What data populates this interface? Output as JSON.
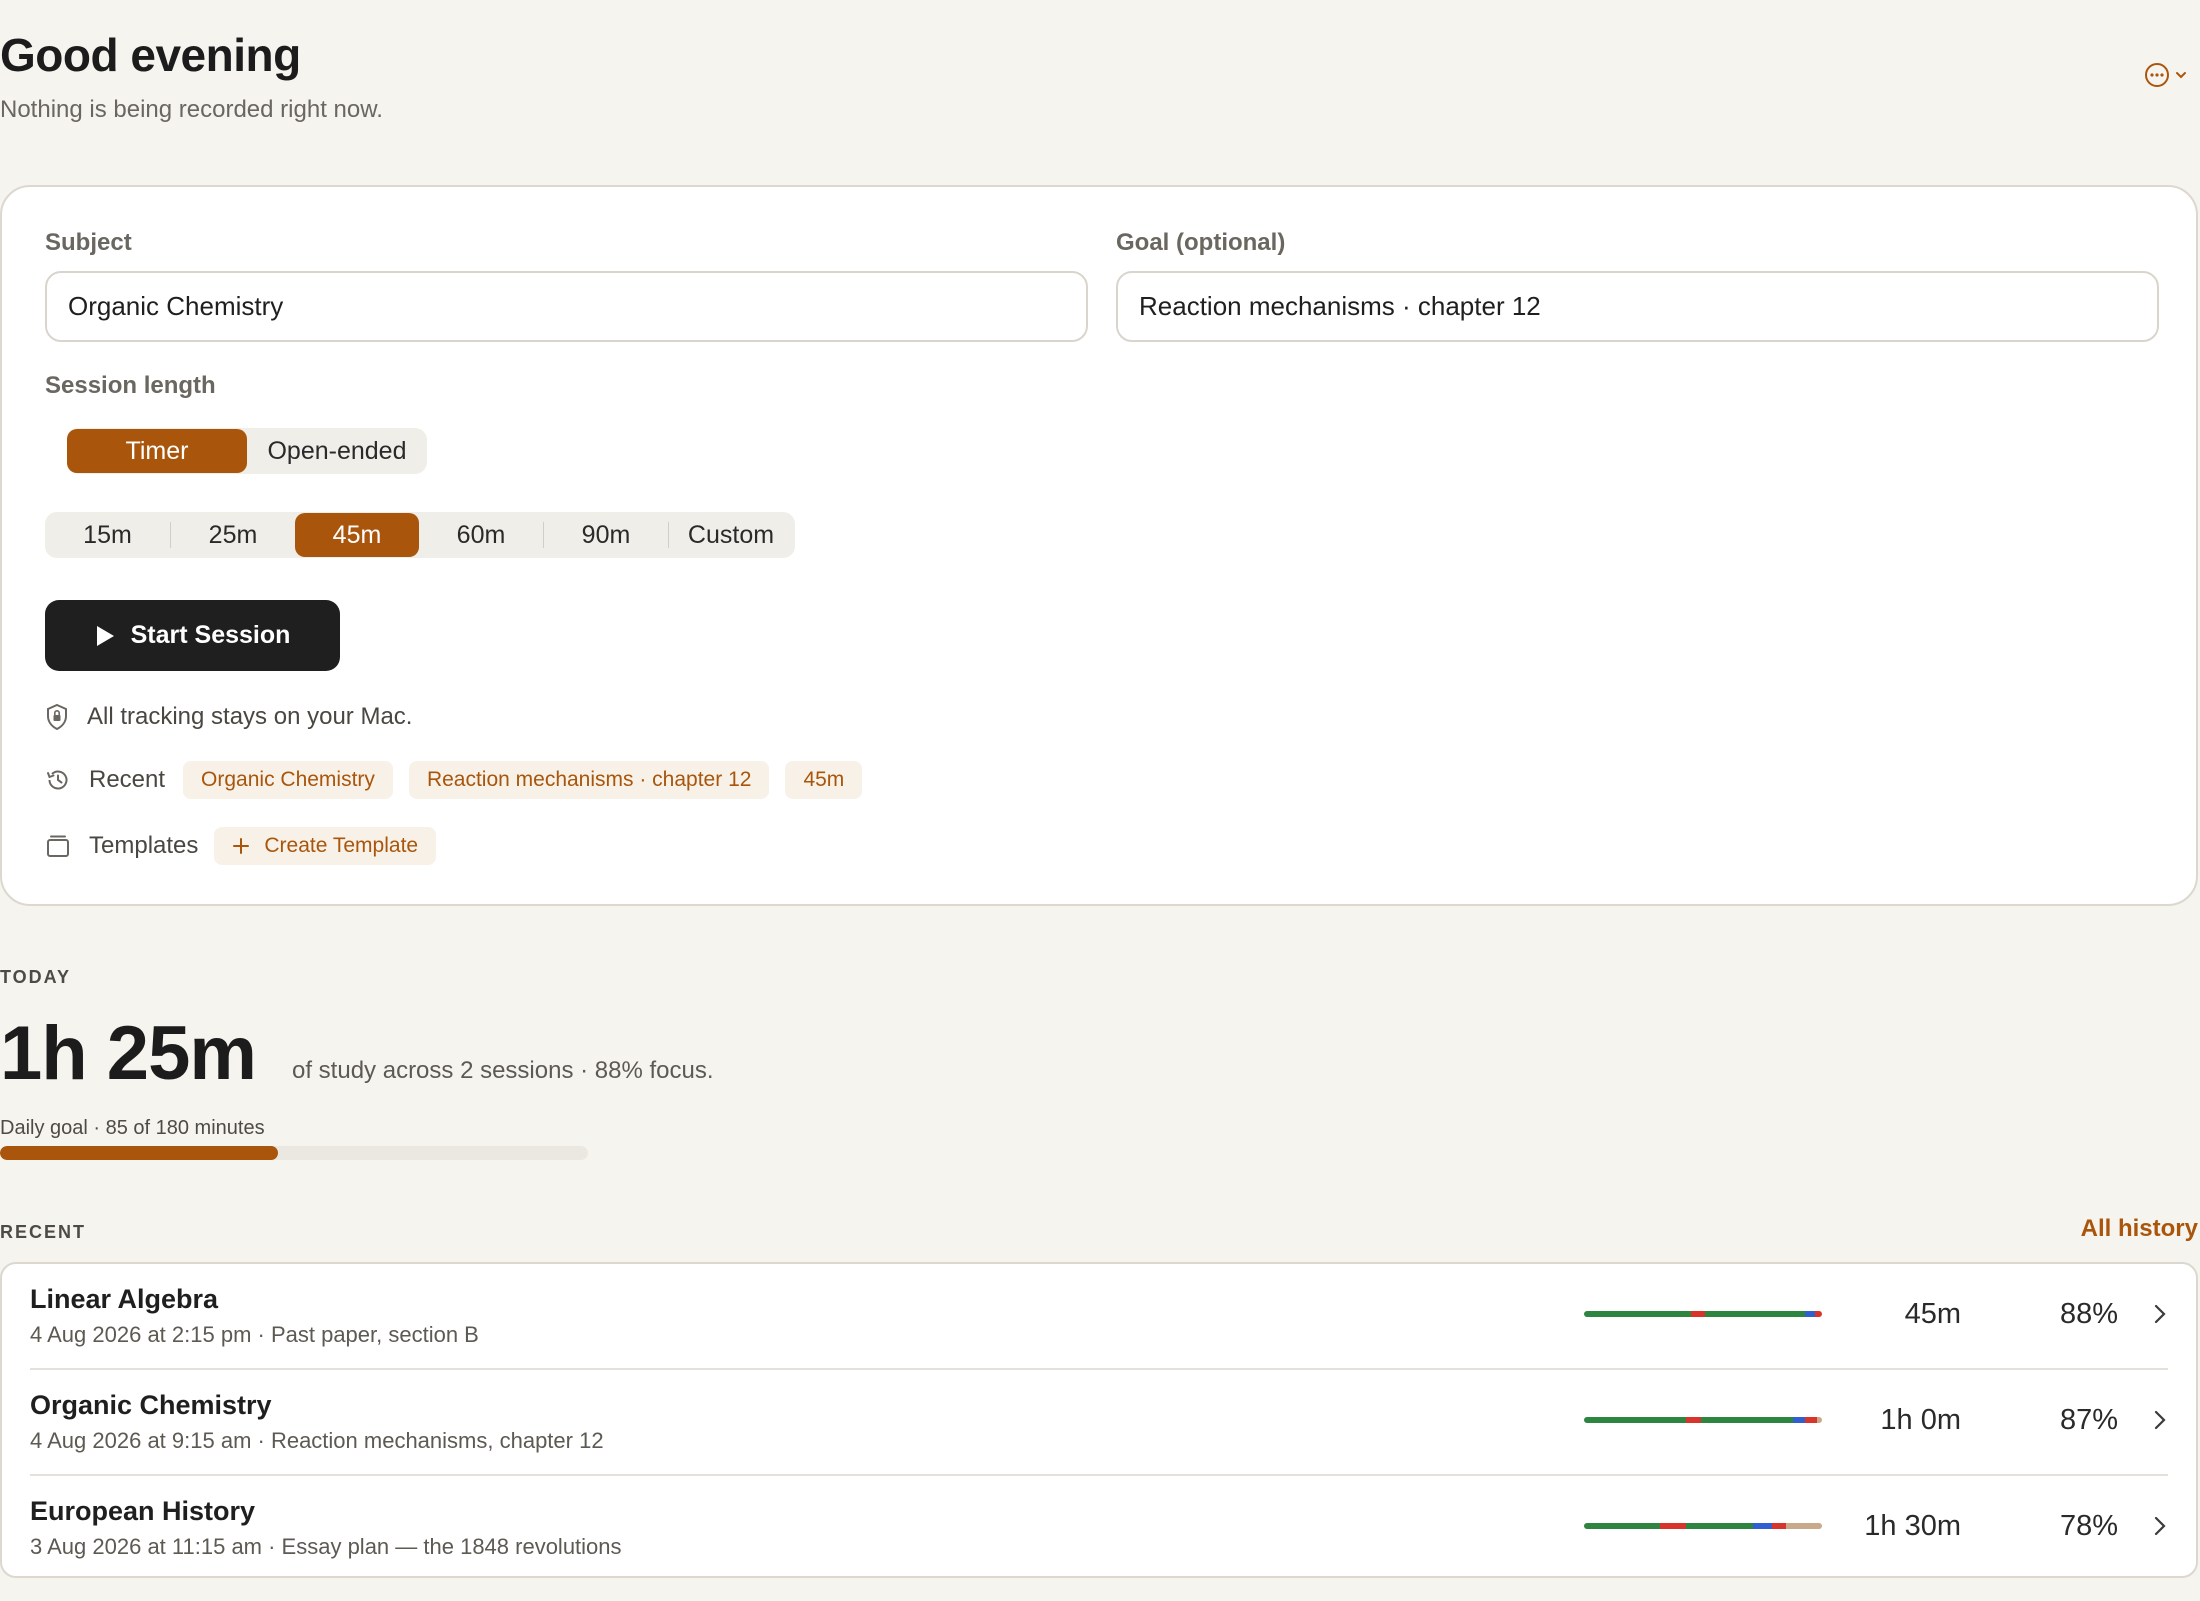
{
  "header": {
    "greeting": "Good evening",
    "status": "Nothing is being recorded right now."
  },
  "form": {
    "subject_label": "Subject",
    "subject_value": "Organic Chemistry",
    "goal_label": "Goal (optional)",
    "goal_value": "Reaction mechanisms · chapter 12",
    "session_length_label": "Session length",
    "mode_options": [
      "Timer",
      "Open-ended"
    ],
    "mode_selected": "Timer",
    "duration_options": [
      "15m",
      "25m",
      "45m",
      "60m",
      "90m",
      "Custom"
    ],
    "duration_selected": "45m",
    "start_label": "Start Session",
    "privacy_note": "All tracking stays on your Mac.",
    "recent_label": "Recent",
    "recent_chips": [
      "Organic Chemistry",
      "Reaction mechanisms · chapter 12",
      "45m"
    ],
    "templates_label": "Templates",
    "create_template_label": "Create Template"
  },
  "today": {
    "label": "TODAY",
    "total": "1h 25m",
    "summary": "of study across 2 sessions · 88% focus.",
    "goal_text": "Daily goal · 85 of 180 minutes",
    "goal_minutes": 85,
    "goal_target_minutes": 180
  },
  "recent": {
    "label": "RECENT",
    "all_history_label": "All history",
    "sessions": [
      {
        "title": "Linear Algebra",
        "subtitle": "4 Aug 2026 at 2:15 pm · Past paper, section B",
        "duration": "45m",
        "focus": "88%",
        "timeline": [
          {
            "c": "#2e8540",
            "w": 45
          },
          {
            "c": "#d9342b",
            "w": 6
          },
          {
            "c": "#2e8540",
            "w": 42
          },
          {
            "c": "#2f5fd0",
            "w": 4
          },
          {
            "c": "#d9342b",
            "w": 3
          }
        ]
      },
      {
        "title": "Organic Chemistry",
        "subtitle": "4 Aug 2026 at 9:15 am · Reaction mechanisms, chapter 12",
        "duration": "1h 0m",
        "focus": "87%",
        "timeline": [
          {
            "c": "#2e8540",
            "w": 43
          },
          {
            "c": "#d9342b",
            "w": 6
          },
          {
            "c": "#2e8540",
            "w": 39
          },
          {
            "c": "#2f5fd0",
            "w": 5
          },
          {
            "c": "#d9342b",
            "w": 5
          },
          {
            "c": "#c9a98a",
            "w": 2
          }
        ]
      },
      {
        "title": "European History",
        "subtitle": "3 Aug 2026 at 11:15 am · Essay plan — the 1848 revolutions",
        "duration": "1h 30m",
        "focus": "78%",
        "timeline": [
          {
            "c": "#2e8540",
            "w": 32
          },
          {
            "c": "#d9342b",
            "w": 11
          },
          {
            "c": "#2e8540",
            "w": 28
          },
          {
            "c": "#2f5fd0",
            "w": 8
          },
          {
            "c": "#d9342b",
            "w": 6
          },
          {
            "c": "#c9a98a",
            "w": 15
          }
        ]
      }
    ]
  },
  "icons": {
    "more": "ellipsis-circle-icon",
    "play": "play-icon",
    "shield": "lock-shield-icon",
    "history": "history-clock-icon",
    "templates": "template-box-icon",
    "plus": "plus-icon",
    "chevron": "chevron-right-icon"
  },
  "colors": {
    "accent": "#a9560c",
    "background": "#f6f4ef",
    "primary_button": "#1f1f1f",
    "focus_green": "#2e8540",
    "distraction_red": "#d9342b",
    "switch_blue": "#2f5fd0",
    "idle_tan": "#c9a98a"
  }
}
